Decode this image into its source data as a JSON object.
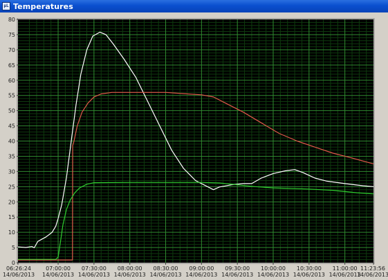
{
  "window": {
    "title": "Temperatures",
    "icon": "labview-vi-icon",
    "icon_text": "µL"
  },
  "colors": {
    "plot_background": "#000000",
    "grid_major": "#2f8a2f",
    "grid_minor": "#0e3a0e",
    "series_white": "#ffffff",
    "series_red": "#e0584a",
    "series_green": "#2fcf2f"
  },
  "chart_data": {
    "type": "line",
    "title": "",
    "xlabel": "",
    "ylabel": "",
    "ylim": [
      0,
      80
    ],
    "yticks": [
      0,
      5,
      10,
      15,
      20,
      25,
      30,
      35,
      40,
      45,
      50,
      55,
      60,
      65,
      70,
      75,
      80
    ],
    "x_unit": "minutes",
    "xlim": [
      "06:26:24",
      "11:23:56"
    ],
    "xticks": [
      {
        "time": "06:26:24",
        "date": "14/06/2013"
      },
      {
        "time": "07:00:00",
        "date": "14/06/2013"
      },
      {
        "time": "07:30:00",
        "date": "14/06/2013"
      },
      {
        "time": "08:00:00",
        "date": "14/06/2013"
      },
      {
        "time": "08:30:00",
        "date": "14/06/2013"
      },
      {
        "time": "09:00:00",
        "date": "14/06/2013"
      },
      {
        "time": "09:30:00",
        "date": "14/06/2013"
      },
      {
        "time": "10:00:00",
        "date": "14/06/2013"
      },
      {
        "time": "10:30:00",
        "date": "14/06/2013"
      },
      {
        "time": "11:00:00",
        "date": "14/06/2013"
      },
      {
        "time": "11:23:56",
        "date": "14/06/2013"
      }
    ],
    "grid": true,
    "series": [
      {
        "color": "#ffffff",
        "points": [
          [
            "06:26:24",
            5.2
          ],
          [
            "06:33:00",
            5.0
          ],
          [
            "06:38:00",
            5.3
          ],
          [
            "06:40:00",
            4.9
          ],
          [
            "06:43:00",
            7.0
          ],
          [
            "06:50:00",
            8.5
          ],
          [
            "06:55:00",
            10.0
          ],
          [
            "06:58:00",
            12.0
          ],
          [
            "07:00:00",
            14.5
          ],
          [
            "07:03:00",
            19.0
          ],
          [
            "07:07:00",
            28.0
          ],
          [
            "07:11:00",
            40.0
          ],
          [
            "07:15:00",
            52.0
          ],
          [
            "07:19:00",
            62.0
          ],
          [
            "07:24:00",
            70.0
          ],
          [
            "07:29:00",
            74.5
          ],
          [
            "07:35:00",
            75.8
          ],
          [
            "07:40:00",
            75.0
          ],
          [
            "07:46:00",
            72.0
          ],
          [
            "07:55:00",
            67.0
          ],
          [
            "08:05:00",
            61.0
          ],
          [
            "08:15:00",
            53.0
          ],
          [
            "08:25:00",
            45.0
          ],
          [
            "08:35:00",
            37.0
          ],
          [
            "08:45:00",
            31.0
          ],
          [
            "08:55:00",
            27.0
          ],
          [
            "09:05:00",
            25.0
          ],
          [
            "09:10:00",
            24.0
          ],
          [
            "09:15:00",
            24.9
          ],
          [
            "09:25:00",
            25.6
          ],
          [
            "09:35:00",
            26.0
          ],
          [
            "09:42:00",
            26.0
          ],
          [
            "09:50:00",
            27.8
          ],
          [
            "10:00:00",
            29.3
          ],
          [
            "10:10:00",
            30.2
          ],
          [
            "10:18:00",
            30.6
          ],
          [
            "10:25:00",
            29.6
          ],
          [
            "10:35:00",
            27.8
          ],
          [
            "10:45:00",
            26.8
          ],
          [
            "11:00:00",
            26.0
          ],
          [
            "11:15:00",
            25.3
          ],
          [
            "11:23:56",
            25.0
          ]
        ]
      },
      {
        "color": "#e0584a",
        "points": [
          [
            "06:26:24",
            0.9
          ],
          [
            "07:12:00",
            0.9
          ],
          [
            "07:12:10",
            38.5
          ],
          [
            "07:13:00",
            39.5
          ],
          [
            "07:16:00",
            45.0
          ],
          [
            "07:20:00",
            49.5
          ],
          [
            "07:25:00",
            52.5
          ],
          [
            "07:30:00",
            54.5
          ],
          [
            "07:36:00",
            55.5
          ],
          [
            "07:45:00",
            56.0
          ],
          [
            "08:00:00",
            56.0
          ],
          [
            "08:30:00",
            56.0
          ],
          [
            "08:45:00",
            55.6
          ],
          [
            "09:00:00",
            55.2
          ],
          [
            "09:10:00",
            54.5
          ],
          [
            "09:20:00",
            52.5
          ],
          [
            "09:35:00",
            49.5
          ],
          [
            "09:50:00",
            46.0
          ],
          [
            "10:05:00",
            42.5
          ],
          [
            "10:20:00",
            40.0
          ],
          [
            "10:35:00",
            38.0
          ],
          [
            "10:50:00",
            36.0
          ],
          [
            "11:05:00",
            34.5
          ],
          [
            "11:23:56",
            32.5
          ]
        ]
      },
      {
        "color": "#2fcf2f",
        "points": [
          [
            "06:26:24",
            1.1
          ],
          [
            "06:58:00",
            1.1
          ],
          [
            "07:00:00",
            1.8
          ],
          [
            "07:02:00",
            7.0
          ],
          [
            "07:04:00",
            12.5
          ],
          [
            "07:07:00",
            17.5
          ],
          [
            "07:10:00",
            20.5
          ],
          [
            "07:14:00",
            23.0
          ],
          [
            "07:18:00",
            24.6
          ],
          [
            "07:24:00",
            25.8
          ],
          [
            "07:30:00",
            26.3
          ],
          [
            "08:00:00",
            26.4
          ],
          [
            "08:30:00",
            26.4
          ],
          [
            "09:00:00",
            26.4
          ],
          [
            "09:15:00",
            26.2
          ],
          [
            "09:30:00",
            25.6
          ],
          [
            "09:45:00",
            25.0
          ],
          [
            "10:00:00",
            24.6
          ],
          [
            "10:30:00",
            24.2
          ],
          [
            "10:50:00",
            23.8
          ],
          [
            "11:10:00",
            23.0
          ],
          [
            "11:23:56",
            22.6
          ]
        ]
      }
    ]
  }
}
